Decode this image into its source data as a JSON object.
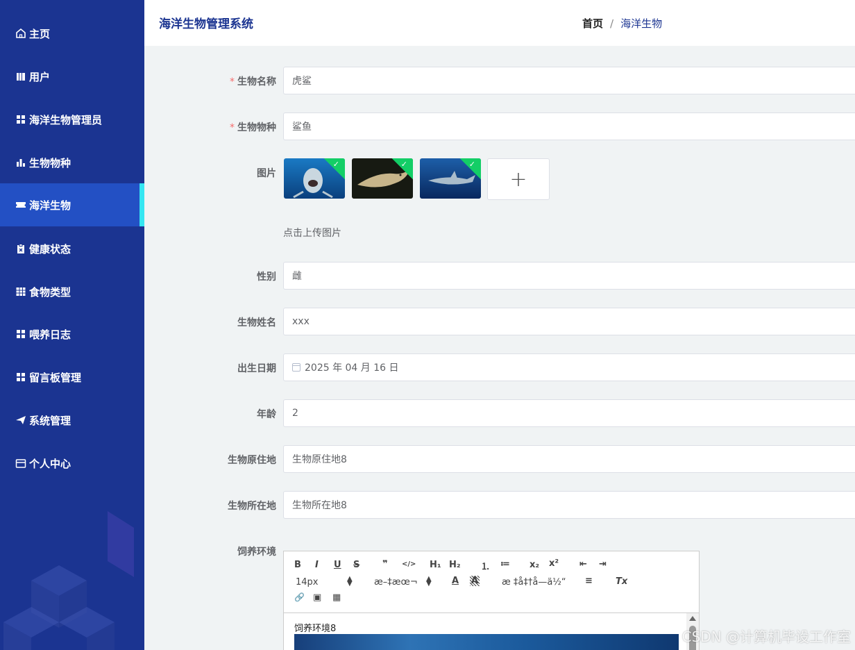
{
  "app": {
    "title": "海洋生物管理系统"
  },
  "breadcrumb": {
    "home": "首页",
    "separator": "/",
    "current": "海洋生物"
  },
  "sidebar": {
    "items": [
      {
        "label": "主页",
        "icon": "home-icon"
      },
      {
        "label": "用户",
        "icon": "user-icon"
      },
      {
        "label": "海洋生物管理员",
        "icon": "grid-icon"
      },
      {
        "label": "生物物种",
        "icon": "bar-chart-icon"
      },
      {
        "label": "海洋生物",
        "icon": "ticket-icon",
        "active": true
      },
      {
        "label": "健康状态",
        "icon": "clipboard-icon"
      },
      {
        "label": "食物类型",
        "icon": "table-icon"
      },
      {
        "label": "喂养日志",
        "icon": "grid-icon"
      },
      {
        "label": "留言板管理",
        "icon": "grid-icon"
      },
      {
        "label": "系统管理",
        "icon": "send-icon"
      },
      {
        "label": "个人中心",
        "icon": "card-icon"
      }
    ]
  },
  "form": {
    "required_mark": "*",
    "name": {
      "label": "生物名称",
      "value": "虎鲨"
    },
    "species": {
      "label": "生物物种",
      "value": "鲨鱼"
    },
    "images": {
      "label": "图片",
      "count": 3,
      "upload_symbol": "+",
      "tip": "点击上传图片"
    },
    "gender": {
      "label": "性别",
      "value": "雌"
    },
    "nickname": {
      "label": "生物姓名",
      "value": "xxx"
    },
    "birth": {
      "label": "出生日期",
      "value": "2025 年 04 月 16 日"
    },
    "age": {
      "label": "年龄",
      "value": "2"
    },
    "origin": {
      "label": "生物原住地",
      "value": "生物原住地8"
    },
    "location": {
      "label": "生物所在地",
      "value": "生物所在地8"
    },
    "environment": {
      "label": "饲养环境",
      "toolbar": {
        "bold": "B",
        "italic": "I",
        "underline": "U",
        "strike": "S",
        "quote": "❞",
        "code": "</>",
        "h1": "H₁",
        "h2": "H₂",
        "ordered_list": "⒈",
        "bullet_list": "≔",
        "sub": "x₂",
        "sup": "x²",
        "outdent": "⇤",
        "indent": "⇥",
        "size": "14px",
        "font": "æ–‡æœ¬",
        "header": "æ ‡å‡†å—ä½“",
        "color": "A",
        "background": "A",
        "align": "≡",
        "clean": "Tx",
        "link": "🔗",
        "image": "▣",
        "video": "▦"
      },
      "content": "饲养环境8"
    }
  },
  "watermark": "CSDN @计算机毕设工作室",
  "colors": {
    "sidebar": "#1b3491",
    "active": "#2350c4",
    "active_bar": "#35e6f2",
    "required": "#f56c6c",
    "upload_ok": "#13ce66"
  }
}
